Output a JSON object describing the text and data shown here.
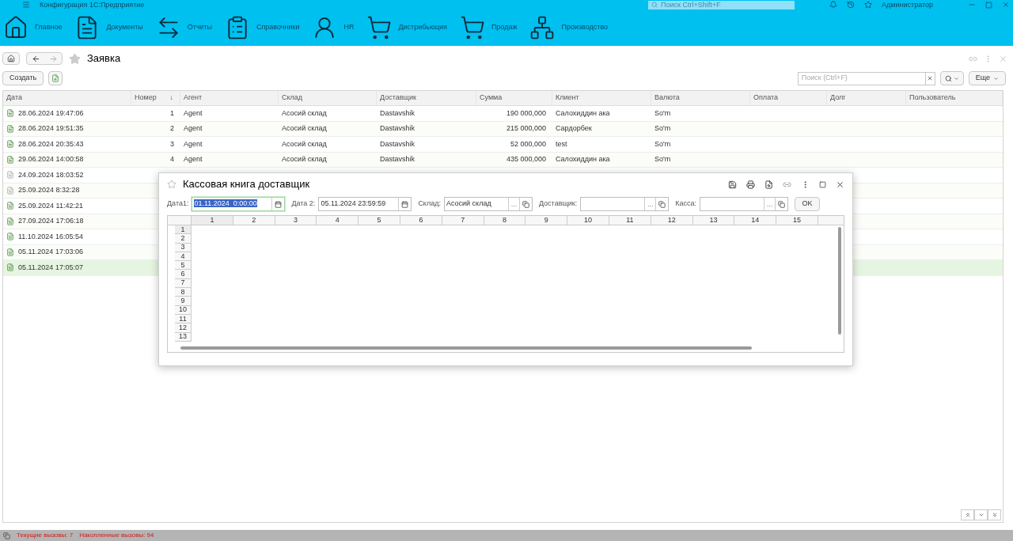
{
  "title_bar": {
    "title": "Конфигурация 1С:Предприятие",
    "search_placeholder": "Поиск Ctrl+Shift+F",
    "user": "Администратор"
  },
  "sections": [
    {
      "label": "Главное"
    },
    {
      "label": "Документы"
    },
    {
      "label": "Отчеты"
    },
    {
      "label": "Справочники"
    },
    {
      "label": "HR"
    },
    {
      "label": "Дистрибьюция"
    },
    {
      "label": "Продаж"
    },
    {
      "label": "Производство"
    }
  ],
  "page": {
    "title": "Заявка",
    "favorite": false,
    "create_button": "Создать",
    "search_placeholder": "Поиск (Ctrl+F)",
    "more_button": "Еще"
  },
  "table": {
    "columns": [
      {
        "label": "Дата"
      },
      {
        "label": "Номер",
        "sort": "↓"
      },
      {
        "label": "Агент"
      },
      {
        "label": "Склад"
      },
      {
        "label": "Доставщик"
      },
      {
        "label": "Сумма"
      },
      {
        "label": "Клиент"
      },
      {
        "label": "Валюта"
      },
      {
        "label": "Оплата"
      },
      {
        "label": "Долг"
      },
      {
        "label": "Пользователь"
      }
    ],
    "rows": [
      {
        "posted": true,
        "selected": false,
        "cells": [
          "28.06.2024 19:47:06",
          "1",
          "Agent",
          "Асосий склад",
          "Dastavshik",
          "190 000,000",
          "Салохиддин ака",
          "So'm"
        ]
      },
      {
        "posted": true,
        "selected": false,
        "cells": [
          "28.06.2024 19:51:35",
          "2",
          "Agent",
          "Асосий склад",
          "Dastavshik",
          "215 000,000",
          "Сардорбек",
          "So'm"
        ]
      },
      {
        "posted": true,
        "selected": false,
        "cells": [
          "28.06.2024 20:35:43",
          "3",
          "Agent",
          "Асосий склад",
          "Dastavshik",
          "52 000,000",
          "test",
          "So'm"
        ]
      },
      {
        "posted": true,
        "selected": false,
        "cells": [
          "29.06.2024 14:00:58",
          "4",
          "Agent",
          "Асосий склад",
          "Dastavshik",
          "435 000,000",
          "Салохиддин ака",
          "So'm"
        ]
      },
      {
        "posted": false,
        "selected": false,
        "cells": [
          "24.09.2024 18:03:52"
        ]
      },
      {
        "posted": false,
        "selected": false,
        "cells": [
          "25.09.2024 8:32:28"
        ]
      },
      {
        "posted": true,
        "selected": false,
        "cells": [
          "25.09.2024 11:42:21"
        ]
      },
      {
        "posted": true,
        "selected": false,
        "cells": [
          "27.09.2024 17:06:18"
        ]
      },
      {
        "posted": true,
        "selected": false,
        "cells": [
          "11.10.2024 16:05:54"
        ]
      },
      {
        "posted": true,
        "selected": false,
        "cells": [
          "05.11.2024 17:03:06"
        ]
      },
      {
        "posted": true,
        "selected": true,
        "cells": [
          "05.11.2024 17:05:07"
        ]
      }
    ]
  },
  "dialog": {
    "title": "Кассовая книга доставщик",
    "favorite": false,
    "fields": [
      {
        "kind": "date",
        "label": "Дата1:",
        "value": "01.11.2024  0:00:00",
        "selected": true
      },
      {
        "kind": "date",
        "label": "Дата 2:",
        "value": "05.11.2024 23:59:59",
        "selected": false
      },
      {
        "kind": "ref",
        "label": "Склад:",
        "value": "Асосий склад",
        "choose": "...",
        "selected": false
      },
      {
        "kind": "ref",
        "label": "Доставщик:",
        "choose": "...",
        "selected": false
      },
      {
        "kind": "ref",
        "label": "Касса:",
        "choose": "...",
        "selected": false
      }
    ],
    "ok_button": "OK",
    "sheet": {
      "columns": [
        "1",
        "2",
        "3",
        "4",
        "5",
        "6",
        "7",
        "8",
        "9",
        "10",
        "11",
        "12",
        "13",
        "14",
        "15"
      ],
      "rows": [
        "1",
        "2",
        "3",
        "4",
        "5",
        "6",
        "7",
        "8",
        "9",
        "10",
        "11",
        "12",
        "13"
      ]
    }
  },
  "status_bar": {
    "current_calls": "Текущие вызовы: 7",
    "total_calls": "Накопленные вызовы: 94"
  }
}
